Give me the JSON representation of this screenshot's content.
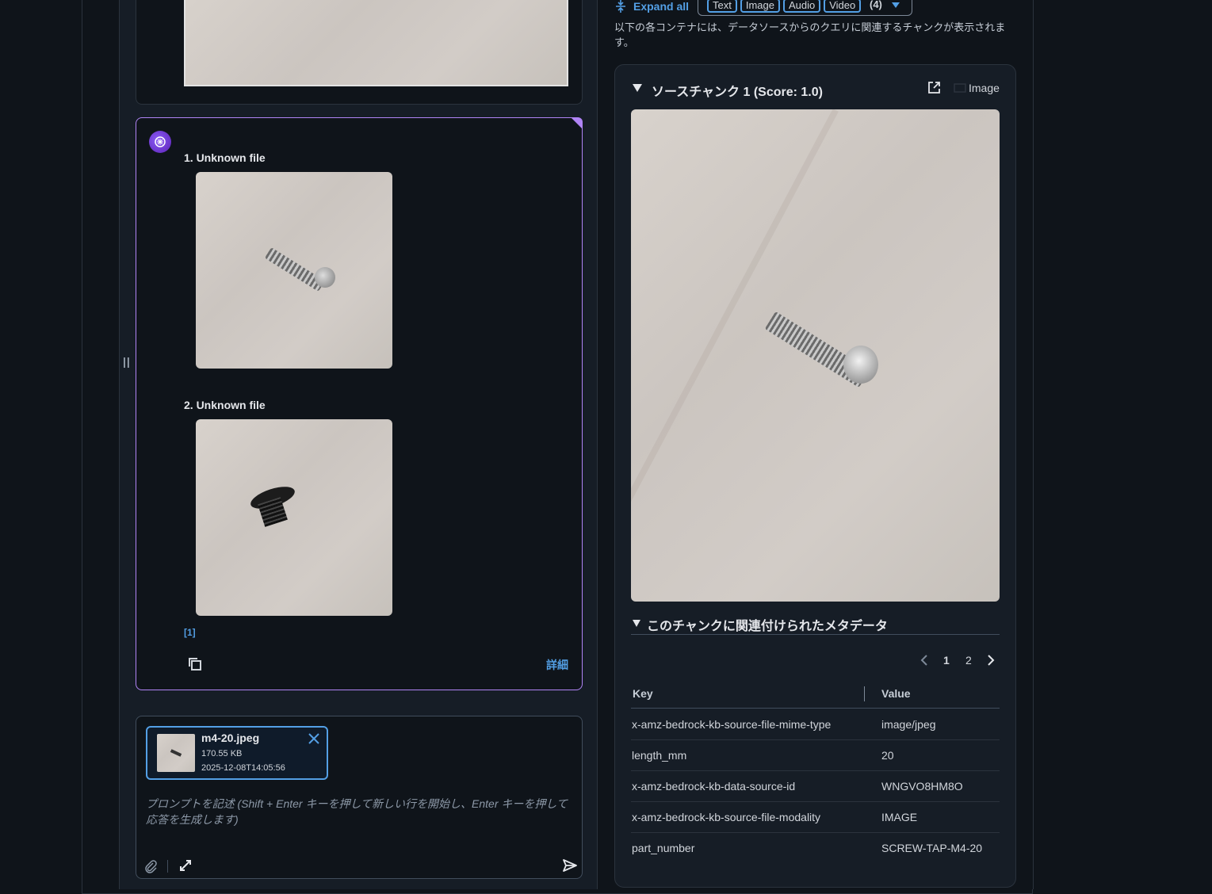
{
  "top_controls": {
    "expand_all": "Expand all",
    "filters": [
      "Text",
      "Image",
      "Audio",
      "Video"
    ],
    "filter_count": "(4)"
  },
  "description": "以下の各コンテナには、データソースからのクエリに関連するチャンクが表示されます。",
  "response": {
    "items": [
      {
        "label": "1. Unknown file"
      },
      {
        "label": "2. Unknown file"
      }
    ],
    "citation": "[1]",
    "detail_link": "詳細"
  },
  "attachment": {
    "name": "m4-20.jpeg",
    "size": "170.55 KB",
    "timestamp": "2025-12-08T14:05:56"
  },
  "prompt_placeholder": "プロンプトを記述 (Shift + Enter キーを押して新しい行を開始し、Enter キーを押して応答を生成します)",
  "chunk": {
    "title": "ソースチャンク 1 (Score: 1.0)",
    "modality": "Image",
    "metadata_title": "このチャンクに関連付けられたメタデータ",
    "pagination": {
      "pages": [
        "1",
        "2"
      ],
      "current": "1"
    },
    "table": {
      "headers": [
        "Key",
        "Value"
      ],
      "rows": [
        [
          "x-amz-bedrock-kb-source-file-mime-type",
          "image/jpeg"
        ],
        [
          "length_mm",
          "20"
        ],
        [
          "x-amz-bedrock-kb-data-source-id",
          "WNGVO8HM8O"
        ],
        [
          "x-amz-bedrock-kb-source-file-modality",
          "IMAGE"
        ],
        [
          "part_number",
          "SCREW-TAP-M4-20"
        ]
      ]
    }
  },
  "colors": {
    "accent": "#539fe5",
    "ai_border": "#b084f5",
    "background": "#0f141a"
  }
}
